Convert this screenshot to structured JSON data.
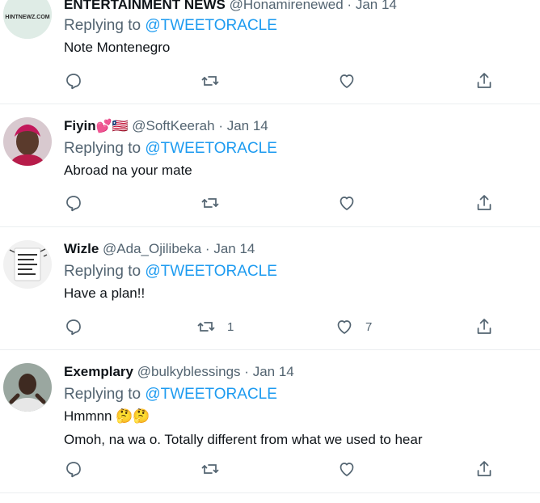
{
  "tweets": [
    {
      "name": "ENTERTAINMENT NEWS",
      "handle": "@Honamirenewed",
      "date": "Jan 14",
      "reply_prefix": "Replying to ",
      "reply_to": "@TWEETORACLE",
      "lines": [
        "Note Montenegro"
      ],
      "avatar_text": "HINTNEWZ.COM",
      "replies": "",
      "retweets": "",
      "likes": ""
    },
    {
      "name": "Fiyin",
      "name_emoji": "💕🇱🇷",
      "handle": "@SoftKeerah",
      "date": "Jan 14",
      "reply_prefix": "Replying to ",
      "reply_to": "@TWEETORACLE",
      "lines": [
        "Abroad na your mate"
      ],
      "replies": "",
      "retweets": "",
      "likes": ""
    },
    {
      "name": "Wizle",
      "handle": "@Ada_Ojilibeka",
      "date": "Jan 14",
      "reply_prefix": "Replying to ",
      "reply_to": "@TWEETORACLE",
      "lines": [
        "Have a plan!!"
      ],
      "avatar_text": "THEY WINGS WERE READY HEARTS",
      "replies": "",
      "retweets": "1",
      "likes": "7"
    },
    {
      "name": "Exemplary",
      "handle": "@bulkyblessings",
      "date": "Jan 14",
      "reply_prefix": "Replying to ",
      "reply_to": "@TWEETORACLE",
      "lines": [
        "Hmmnn 🤔🤔",
        "Omoh, na wa o. Totally different from what we used to hear"
      ],
      "replies": "",
      "retweets": "",
      "likes": ""
    }
  ],
  "separator": "·",
  "colors": {
    "mention": "#1d9bf0",
    "muted": "#536471",
    "text": "#0f1419",
    "divider": "#ebeef0"
  }
}
